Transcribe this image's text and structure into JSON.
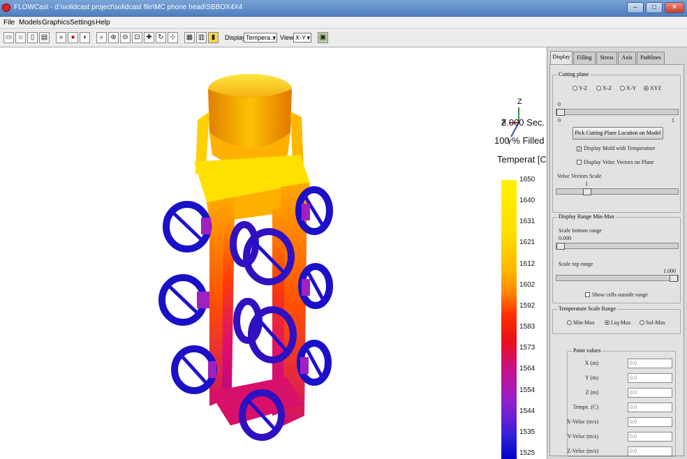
{
  "window": {
    "title": "FLOWCast - d:\\solidcast project\\solidcast file\\MC phone head\\SBBOX4X4",
    "controls": {
      "minimize": "–",
      "maximize": "□",
      "close": "✕"
    }
  },
  "menu": {
    "items": [
      "File",
      "Models",
      "Graphics",
      "Settings",
      "Help"
    ]
  },
  "toolbar": {
    "display_label": "Display:",
    "display_value": "Tempera...",
    "view_label": "View:",
    "view_value": "X-Y"
  },
  "simulation": {
    "time": "2.000 Sec.",
    "filled": "100 % Filled",
    "field": "Temperat [C]"
  },
  "axes": {
    "x": "X",
    "y": "Y",
    "z": "Z"
  },
  "legend": {
    "ticks": [
      "1650",
      "1640",
      "1631",
      "1621",
      "1612",
      "1602",
      "1592",
      "1583",
      "1573",
      "1564",
      "1554",
      "1544",
      "1535",
      "1525"
    ],
    "colors": [
      "#fff200",
      "#ffb800",
      "#ff3000",
      "#c8108a",
      "#9020d0",
      "#0000c8"
    ]
  },
  "panel": {
    "tabs": [
      "Display",
      "Filling",
      "Stress",
      "Axis",
      "Pathlines"
    ],
    "cutting_plane": {
      "title": "Cutting plane",
      "options": [
        "Y-Z",
        "X-Z",
        "X-Y",
        "XYZ"
      ],
      "selected": "XYZ",
      "slider_top": "0",
      "slider_min": "0",
      "slider_max": "1",
      "pick_button": "Pick Cutting Plane Location on Model",
      "display_mold": "Display Mold with Temperature",
      "display_mold_checked": true,
      "display_veloc": "Display Veloc Vectors on Plane",
      "display_veloc_checked": false,
      "veloc_scale_label": "Veloc Vectors Scale",
      "veloc_scale_value": "1"
    },
    "display_range": {
      "title": "Display Range Min-Max",
      "bottom_label": "Scale bottom range",
      "bottom_value": "0.000",
      "top_label": "Scale top range",
      "top_value": "1.000",
      "show_cells": "Show cells outside range",
      "show_cells_checked": false
    },
    "temp_scale": {
      "title": "Temperature Scale Range",
      "options": [
        "Min-Max",
        "Liq-Max",
        "Sol-Max"
      ],
      "selected": "Liq-Max"
    },
    "point_values": {
      "title": "Point values",
      "rows": [
        {
          "label": "X (m)",
          "value": "0.0"
        },
        {
          "label": "Y (m)",
          "value": "0.0"
        },
        {
          "label": "Z (m)",
          "value": "0.0"
        },
        {
          "label": "Tempe. (C)",
          "value": "0.0"
        },
        {
          "label": "X-Veloc (m/s)",
          "value": "0.0"
        },
        {
          "label": "Y-Veloc (m/s)",
          "value": "0.0"
        },
        {
          "label": "Z-Veloc (m/s)",
          "value": "0.0"
        }
      ]
    }
  }
}
